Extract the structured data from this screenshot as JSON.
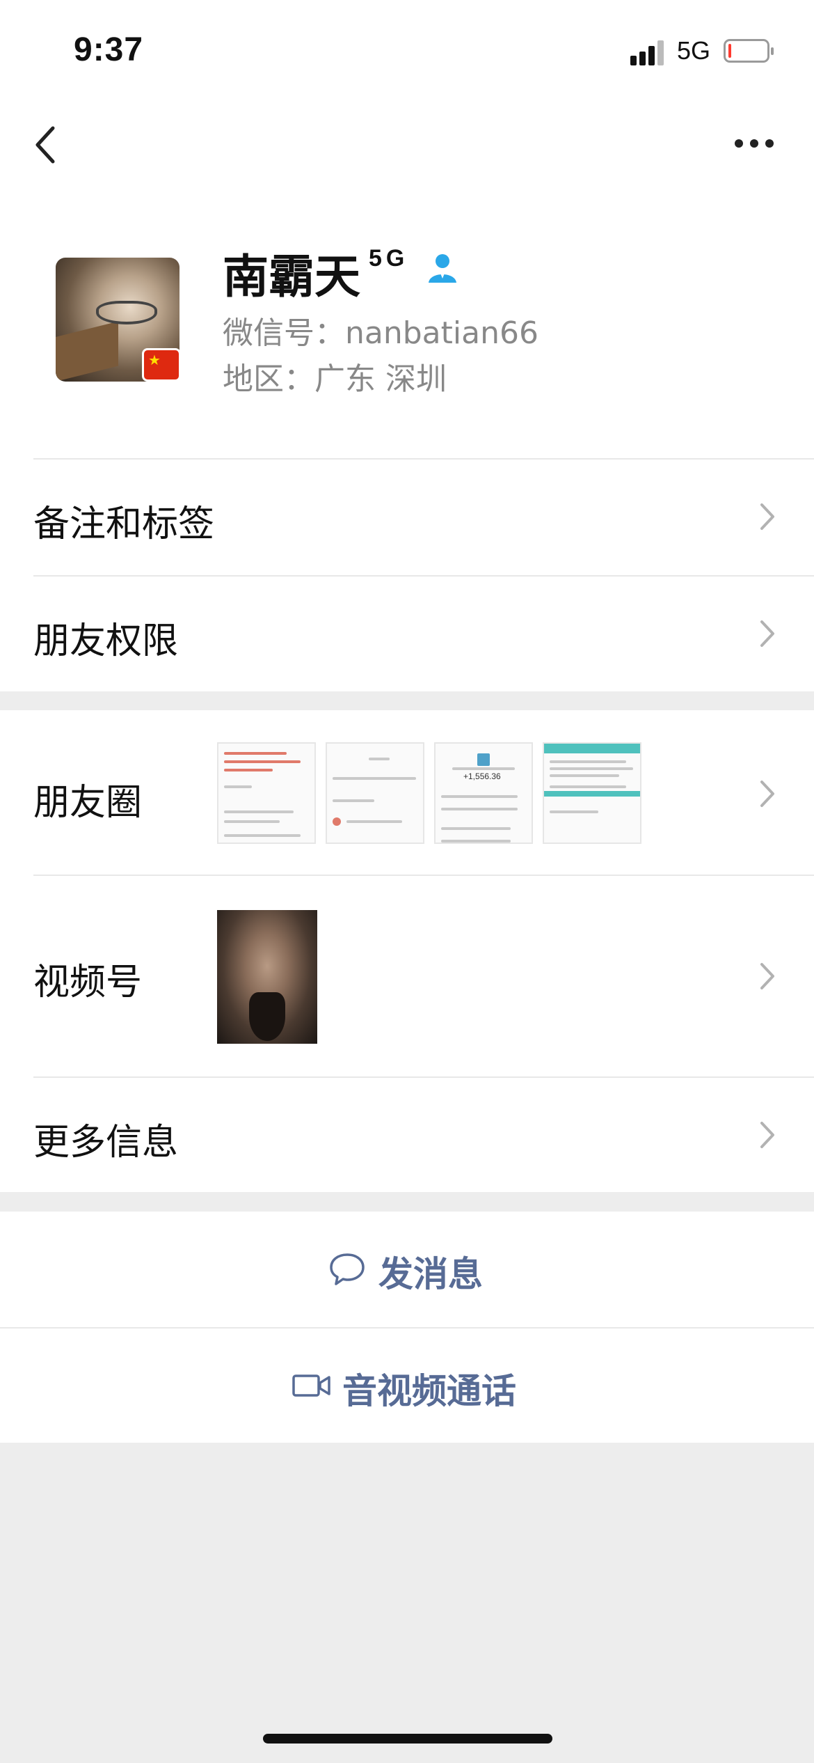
{
  "status_bar": {
    "time": "9:37",
    "network": "5G",
    "battery_level": 0.05
  },
  "nav": {
    "back_icon": "chevron-left-icon",
    "more_icon": "more-dots-icon"
  },
  "profile": {
    "name": "南霸天",
    "name_suffix": "5G",
    "wechat_id": "微信号：nanbatian66",
    "region": "地区：广东 深圳",
    "verified_icon": "user-badge-icon"
  },
  "rows": {
    "remarks_tags": "备注和标签",
    "friend_permissions": "朋友权限",
    "moments": "朋友圈",
    "channels": "视频号",
    "more_info": "更多信息"
  },
  "moments_thumbs": {
    "thumb2_amount": "+1,556.36"
  },
  "actions": {
    "send_message": "发消息",
    "video_call": "音视频通话"
  },
  "colors": {
    "link_blue": "#576b95",
    "background": "#ededed",
    "verified": "#2aa7e8"
  }
}
